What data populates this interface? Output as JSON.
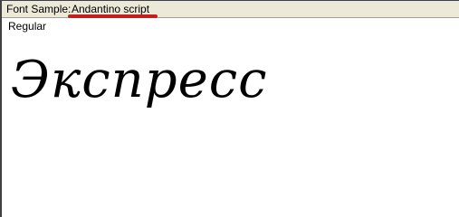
{
  "header": {
    "label": "Font Sample:",
    "font_name": "Andantino script"
  },
  "style": "Regular",
  "sample_text": "Экспресс",
  "colors": {
    "toolbar_bg": "#ece9d8",
    "annotation_red": "#c41e1e",
    "text": "#000000"
  }
}
